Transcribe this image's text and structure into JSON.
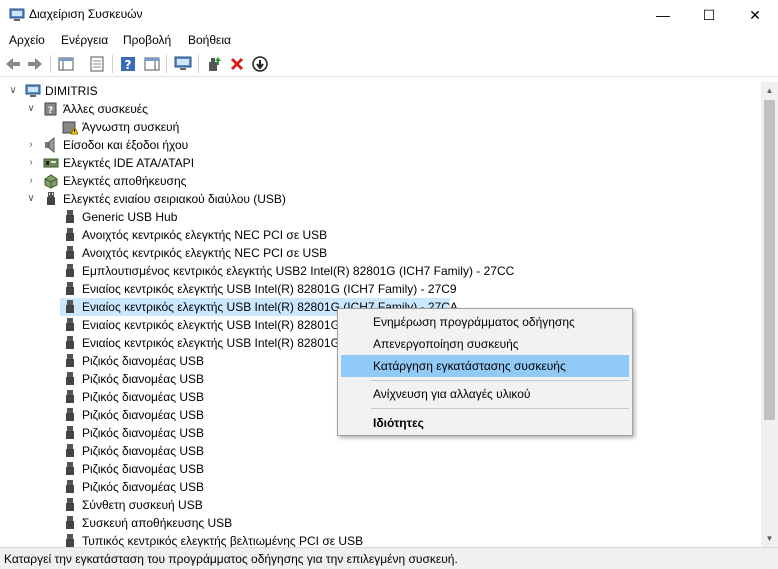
{
  "window": {
    "title": "Διαχείριση Συσκευών",
    "minimize_glyph": "—",
    "maximize_glyph": "☐",
    "close_glyph": "✕"
  },
  "menu": [
    "Αρχείο",
    "Ενέργεια",
    "Προβολή",
    "Βοήθεια"
  ],
  "toolbar": {
    "icons": [
      "back-icon",
      "forward-icon",
      "show-hide-console-tree-icon",
      "properties-icon",
      "help-icon",
      "action-pane-icon",
      "monitor-icon",
      "update-driver-icon",
      "uninstall-device-icon",
      "disable-device-icon"
    ]
  },
  "tree": {
    "root": "DIMITRIS",
    "other_devices": "Άλλες συσκευές",
    "unknown_device": "Άγνωστη συσκευή",
    "audio": "Είσοδοι και έξοδοι ήχου",
    "ide": "Ελεγκτές IDE ATA/ATAPI",
    "storage": "Ελεγκτές αποθήκευσης",
    "usb": "Ελεγκτές ενιαίου σειριακού διαύλου (USB)",
    "usb_children": [
      "Generic USB Hub",
      "Ανοιχτός κεντρικός ελεγκτής NEC PCI σε USB",
      "Ανοιχτός κεντρικός ελεγκτής NEC PCI σε USB",
      "Εμπλουτισμένος κεντρικός ελεγκτής USB2 Intel(R) 82801G (ICH7 Family) - 27CC",
      "Ενιαίος κεντρικός ελεγκτής USB Intel(R) 82801G (ICH7 Family) - 27C9",
      "Ενιαίος κεντρικός ελεγκτής USB Intel(R) 82801G (ICH7 Family) - 27CA",
      "Ενιαίος κεντρικός ελεγκτής USB Intel(R) 82801G",
      "Ενιαίος κεντρικός ελεγκτής USB Intel(R) 82801G",
      "Ριζικός διανομέας USB",
      "Ριζικός διανομέας USB",
      "Ριζικός διανομέας USB",
      "Ριζικός διανομέας USB",
      "Ριζικός διανομέας USB",
      "Ριζικός διανομέας USB",
      "Ριζικός διανομέας USB",
      "Ριζικός διανομέας USB",
      "Σύνθετη συσκευή USB",
      "Συσκευή αποθήκευσης USB",
      "Τυπικός κεντρικός ελεγκτής βελτιωμένης PCI σε USB"
    ]
  },
  "context_menu": {
    "update_driver": "Ενημέρωση προγράμματος οδήγησης",
    "disable": "Απενεργοποίηση συσκευής",
    "uninstall": "Κατάργηση εγκατάστασης συσκευής",
    "scan": "Ανίχνευση για αλλαγές υλικού",
    "properties": "Ιδιότητες"
  },
  "status": "Καταργεί την εγκατάσταση του προγράμματος οδήγησης για την επιλεγμένη συσκευή."
}
